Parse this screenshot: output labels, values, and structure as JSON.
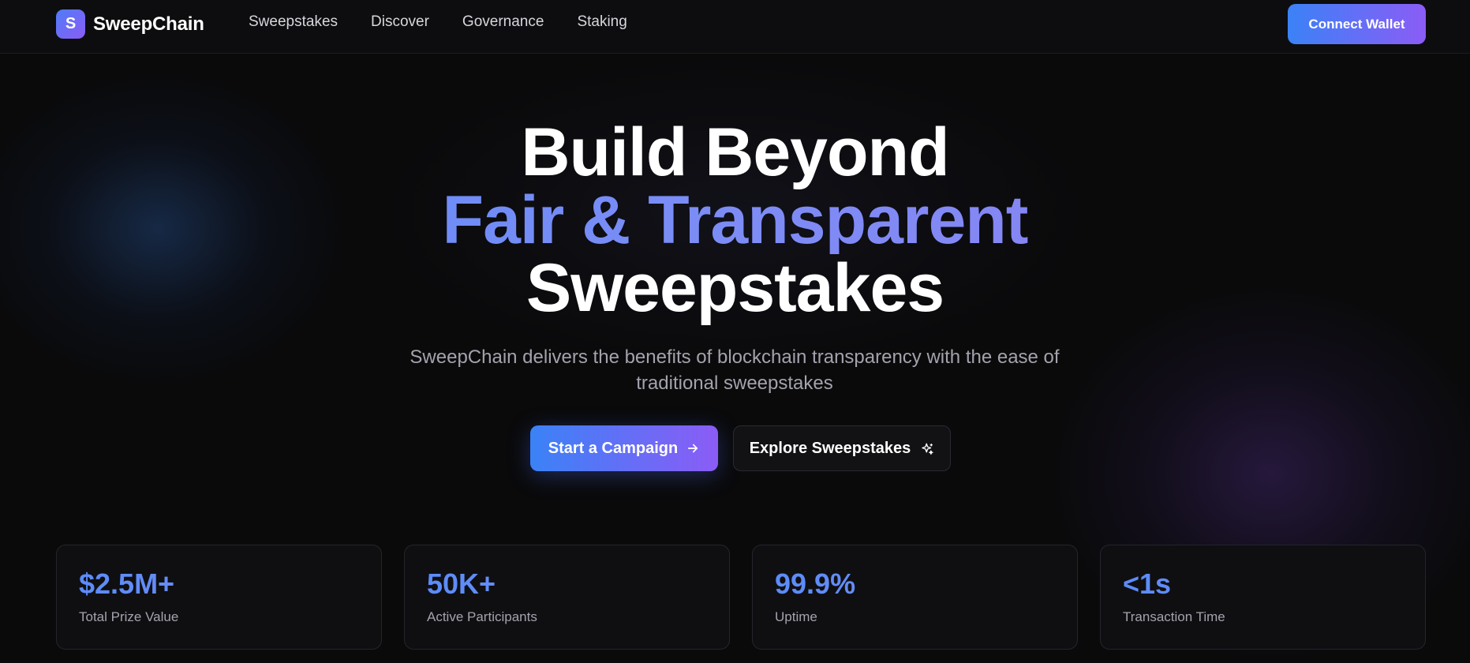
{
  "brand": {
    "logo_letter": "S",
    "name": "SweepChain"
  },
  "nav": {
    "links": [
      "Sweepstakes",
      "Discover",
      "Governance",
      "Staking"
    ],
    "connect_label": "Connect Wallet"
  },
  "hero": {
    "title_line1": "Build Beyond",
    "title_line2": "Fair & Transparent",
    "title_line3": "Sweepstakes",
    "subtitle": "SweepChain delivers the benefits of blockchain transparency with the ease of traditional sweepstakes",
    "primary_cta": "Start a Campaign",
    "secondary_cta": "Explore Sweepstakes"
  },
  "stats": [
    {
      "value": "$2.5M+",
      "label": "Total Prize Value"
    },
    {
      "value": "50K+",
      "label": "Active Participants"
    },
    {
      "value": "99.9%",
      "label": "Uptime"
    },
    {
      "value": "<1s",
      "label": "Transaction Time"
    }
  ],
  "icons": {
    "primary_cta": "arrow-right-icon",
    "secondary_cta": "sparkles-icon"
  },
  "colors": {
    "background": "#0a0a0b",
    "accent_blue": "#3b82f6",
    "accent_purple": "#8b5cf6",
    "muted_text": "#a3a3ad"
  }
}
